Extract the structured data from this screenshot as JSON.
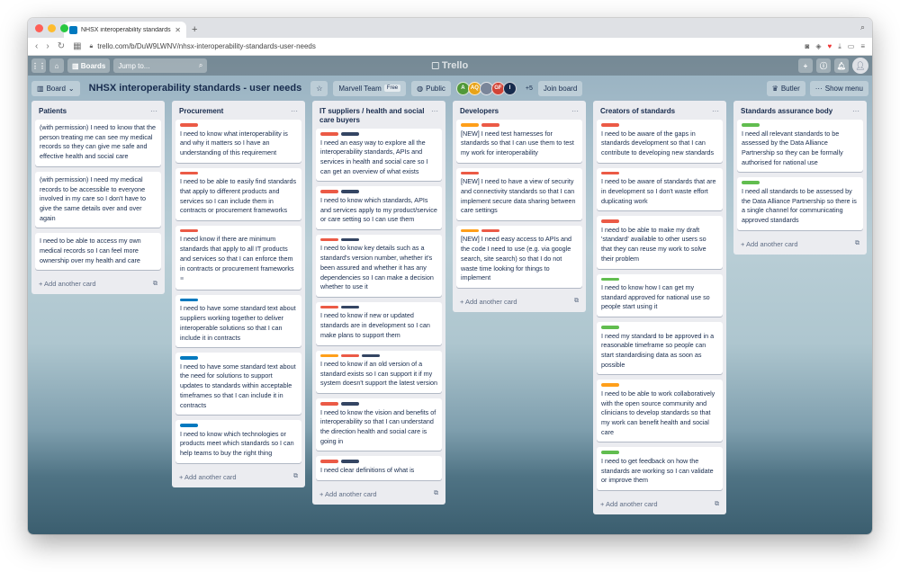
{
  "browser": {
    "tab_title": "NHSX interoperability standards",
    "url": "trello.com/b/DuW9LWNV/nhsx-interoperability-standards-user-needs"
  },
  "topnav": {
    "boards_label": "Boards",
    "jump_label": "Jump to...",
    "logo_text": "Trello"
  },
  "board": {
    "view_label": "Board",
    "title": "NHSX interoperability standards - user needs",
    "team": "Marvell Team",
    "team_badge": "Free",
    "visibility": "Public",
    "members": [
      {
        "initials": "A",
        "color": "#519839"
      },
      {
        "initials": "AQ",
        "color": "#e8a317"
      },
      {
        "initials": "",
        "color": "#7a869a"
      },
      {
        "initials": "GF",
        "color": "#d04437"
      },
      {
        "initials": "I",
        "color": "#172b4d"
      }
    ],
    "members_more": "+5",
    "join_label": "Join board",
    "butler_label": "Butler",
    "menu_label": "Show menu"
  },
  "add_card_label": "+ Add another card",
  "lists": [
    {
      "title": "Patients",
      "cards": [
        {
          "labels": [],
          "text": "(with permission) I need to know that the person treating me can see my medical records so they can give me safe and effective health and social care"
        },
        {
          "labels": [],
          "text": "(with permission) I need my medical records to be accessible to everyone involved in my care so I don't have to give the same details over and over again"
        },
        {
          "labels": [],
          "text": "I need to be able to access my own medical records so I can feel more ownership over my health and care"
        }
      ]
    },
    {
      "title": "Procurement",
      "cards": [
        {
          "labels": [
            "red"
          ],
          "text": "I need to know what interoperability is and why it matters so I have an understanding of this requirement"
        },
        {
          "labels": [
            "red"
          ],
          "text": "I need to be able to easily find standards that apply to different products and services so I can include them in contracts or procurement frameworks"
        },
        {
          "labels": [
            "red"
          ],
          "text": "I need know if there are minimum standards that apply to all IT products and services so that I can enforce them in contracts or procurement frameworks",
          "desc": "≡"
        },
        {
          "labels": [
            "blue"
          ],
          "text": "I need to have some standard text about suppliers working together to deliver interoperable solutions so that I can include it in contracts"
        },
        {
          "labels": [
            "blue"
          ],
          "text": "I need to have some standard text about the need for solutions to support updates to standards within acceptable timeframes so that I can include it in contracts"
        },
        {
          "labels": [
            "blue"
          ],
          "text": "I need to know which technologies or products meet which standards so I can help teams to buy the right thing"
        }
      ]
    },
    {
      "title": "IT suppliers / health and social care buyers",
      "cards": [
        {
          "labels": [
            "red",
            "navy"
          ],
          "text": "I need an easy way to explore all the interoperability standards, APIs and services in health and social care so I can get an overview of what exists"
        },
        {
          "labels": [
            "red",
            "navy"
          ],
          "text": "I need to know which standards, APIs and services apply to my product/service or care setting so I can use them"
        },
        {
          "labels": [
            "red",
            "navy"
          ],
          "text": "I need to know key details such as a standard's version number, whether it's been assured and whether it has any dependencies so I can make a decision whether to use it"
        },
        {
          "labels": [
            "red",
            "navy"
          ],
          "text": "I need to know if new or updated standards are in development so I can make plans to support them"
        },
        {
          "labels": [
            "orange",
            "red",
            "navy"
          ],
          "text": "I need to know if an old version of a standard exists so I can support it if my system doesn't support the latest version"
        },
        {
          "labels": [
            "red",
            "navy"
          ],
          "text": "I need to know the vision and benefits of interoperability so that I can understand the direction health and social care is going in"
        },
        {
          "labels": [
            "red",
            "navy"
          ],
          "text": "I need clear definitions of what is"
        }
      ]
    },
    {
      "title": "Developers",
      "cards": [
        {
          "labels": [
            "orange",
            "red"
          ],
          "text": "[NEW] I need test harnesses for standards so that I can use them to test my work for interoperability"
        },
        {
          "labels": [
            "red"
          ],
          "text": "[NEW] I need to have a view of security and connectivity standards so that I can implement secure data sharing between care settings"
        },
        {
          "labels": [
            "orange",
            "red"
          ],
          "text": "[NEW] I need easy access to APIs and the code I need to use (e.g. via google search, site search) so that I do not waste time looking for things to implement"
        }
      ]
    },
    {
      "title": "Creators of standards",
      "cards": [
        {
          "labels": [
            "red"
          ],
          "text": "I need to be aware of the gaps in standards development so that I can contribute to developing new standards"
        },
        {
          "labels": [
            "red"
          ],
          "text": "I need to be aware of standards that are in development so I don't waste effort duplicating work"
        },
        {
          "labels": [
            "red"
          ],
          "text": "I need to be able to make my draft 'standard' available to other users so that they can reuse my work to solve their problem"
        },
        {
          "labels": [
            "green"
          ],
          "text": "I need to know how I can get my standard approved for national use so people start using it"
        },
        {
          "labels": [
            "green"
          ],
          "text": "I need my standard to be approved in a reasonable timeframe so people can start standardising data as soon as possible"
        },
        {
          "labels": [
            "orange"
          ],
          "text": "I need to be able to work collaboratively with the open source community and clinicians to develop standards so that my work can benefit health and social care"
        },
        {
          "labels": [
            "green"
          ],
          "text": "I need to get feedback on how the standards are working so I can validate or improve them"
        }
      ]
    },
    {
      "title": "Standards assurance body",
      "cards": [
        {
          "labels": [
            "green"
          ],
          "text": "I need all relevant standards to be assessed by the Data Alliance Partnership so they can be formally authorised for national use"
        },
        {
          "labels": [
            "green"
          ],
          "text": "I need all standards to be assessed by the Data Alliance Partnership so there is a single channel for communicating approved standards"
        }
      ]
    }
  ]
}
